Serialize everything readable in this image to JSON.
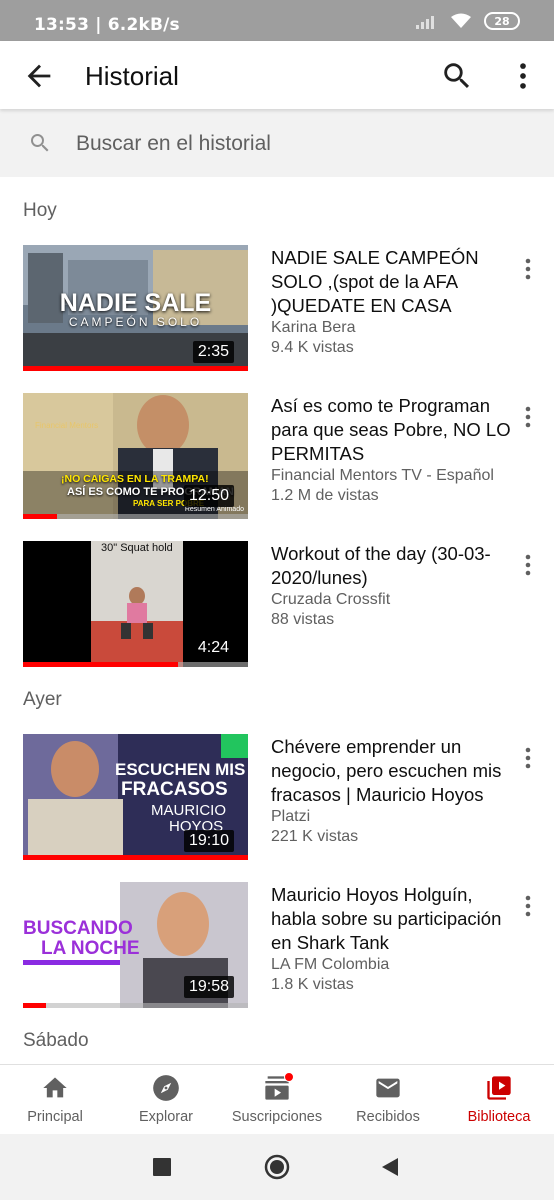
{
  "status_bar": {
    "time": "13:53 | 6.2kB/s",
    "battery": "28"
  },
  "app_bar": {
    "title": "Historial",
    "back_icon": "arrow-back-icon",
    "search_icon": "search-icon",
    "more_icon": "more-vert-icon"
  },
  "search": {
    "placeholder": "Buscar en el historial"
  },
  "sections": [
    {
      "label": "Hoy"
    },
    {
      "label": "Ayer"
    },
    {
      "label": "Sábado"
    }
  ],
  "videos": [
    {
      "title": "NADIE SALE CAMPEÓN SOLO ,(spot de la AFA )QUEDATE EN CASA",
      "channel": "Karina Bera",
      "views": "9.4 K vistas",
      "duration": "2:35",
      "watched_fraction": 1.0,
      "thumb_text_1": "NADIE SALE",
      "thumb_text_2": "CAMPEÓN SOLO"
    },
    {
      "title": "Así es como te Programan para que seas Pobre, NO LO PERMITAS",
      "channel": "Financial Mentors TV - Español",
      "views": "1.2 M de vistas",
      "duration": "12:50",
      "watched_fraction": 0.15,
      "thumb_text_1": "¡NO CAIGAS EN LA TRAMPA!",
      "thumb_text_2": "ASÍ ES COMO TE PROGRAMAN",
      "thumb_text_3": "PARA SER POBRE",
      "thumb_text_4": "Resumen Animado",
      "thumb_text_5": "Financial Mentors"
    },
    {
      "title": "Workout of the day (30-03-2020/lunes)",
      "channel": "Cruzada Crossfit",
      "views": "88 vistas",
      "duration": "4:24",
      "watched_fraction": 0.69,
      "thumb_text_1": "30\" Squat hold"
    },
    {
      "title": "Chévere emprender un negocio, pero escuchen mis fracasos | Mauricio Hoyos",
      "channel": "Platzi",
      "views": "221 K vistas",
      "duration": "19:10",
      "watched_fraction": 1.0,
      "thumb_text_1": "ESCUCHEN MIS",
      "thumb_text_2": "FRACASOS",
      "thumb_text_3": "MAURICIO",
      "thumb_text_4": "HOYOS"
    },
    {
      "title": "Mauricio Hoyos Holguín, habla sobre su participación en Shark Tank",
      "channel": "LA FM Colombia",
      "views": "1.8 K vistas",
      "duration": "19:58",
      "watched_fraction": 0.1,
      "thumb_text_1": "BUSCANDO",
      "thumb_text_2": "LA NOCHE"
    }
  ],
  "bottom_nav": [
    {
      "label": "Principal",
      "icon": "home-icon",
      "active": false
    },
    {
      "label": "Explorar",
      "icon": "explore-icon",
      "active": false
    },
    {
      "label": "Suscripciones",
      "icon": "subscriptions-icon",
      "active": false,
      "badge": true
    },
    {
      "label": "Recibidos",
      "icon": "mail-icon",
      "active": false
    },
    {
      "label": "Biblioteca",
      "icon": "library-icon",
      "active": true
    }
  ],
  "colors": {
    "accent_red": "#ff0000",
    "active_label": "#cc0000",
    "secondary_text": "#606060"
  }
}
